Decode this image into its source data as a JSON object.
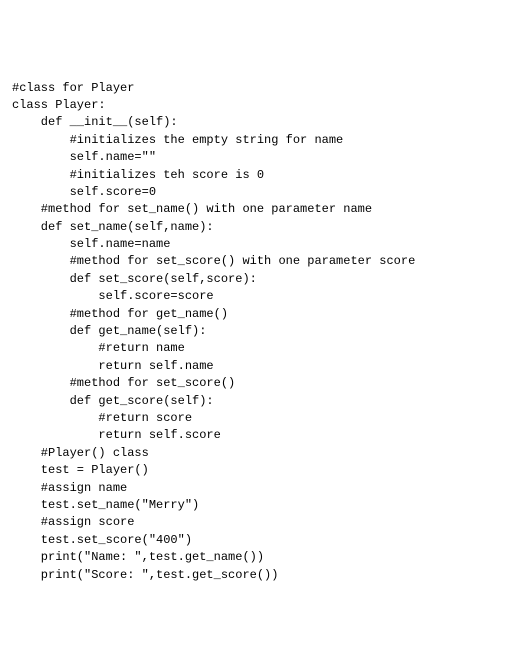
{
  "code": {
    "lines": [
      "#class for Player",
      "class Player:",
      "    def __init__(self):",
      "        #initializes the empty string for name",
      "        self.name=\"\"",
      "        #initializes teh score is 0",
      "        self.score=0",
      "    #method for set_name() with one parameter name",
      "    def set_name(self,name):",
      "        self.name=name",
      "",
      "",
      "",
      "",
      "        #method for set_score() with one parameter score",
      "        def set_score(self,score):",
      "            self.score=score",
      "        #method for get_name()",
      "        def get_name(self):",
      "            #return name",
      "            return self.name",
      "        #method for set_score()",
      "        def get_score(self):",
      "            #return score",
      "            return self.score",
      "    #Player() class",
      "    test = Player()",
      "    #assign name",
      "    test.set_name(\"Merry\")",
      "    #assign score",
      "    test.set_score(\"400\")",
      "    print(\"Name: \",test.get_name())",
      "    print(\"Score: \",test.get_score())"
    ]
  }
}
